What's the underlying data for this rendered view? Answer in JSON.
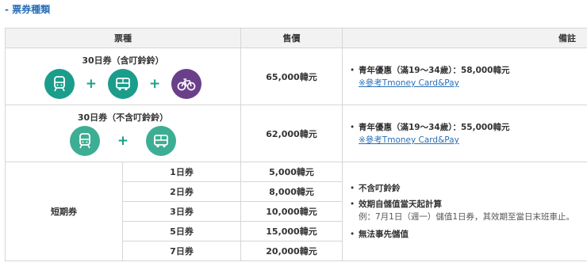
{
  "section_title": "- 票券種類",
  "headers": {
    "col1": "票種",
    "col2": "售價",
    "col3": "備註"
  },
  "pass30_with_bike": {
    "name": "30日券（含叮鈴鈴）",
    "price": "65,000韓元",
    "note": "青年優惠（滿19～34歲）：58,000韓元",
    "link": "※參考Tmoney Card&Pay",
    "icons": [
      "subway-icon",
      "bus-icon",
      "bicycle-icon"
    ],
    "plus": "+"
  },
  "pass30_no_bike": {
    "name": "30日券（不含叮鈴鈴）",
    "price": "62,000韓元",
    "note": "青年優惠（滿19～34歲）：55,000韓元",
    "link": "※參考Tmoney Card&Pay",
    "icons": [
      "subway-icon",
      "bus-icon"
    ],
    "plus": "+"
  },
  "short_term": {
    "label": "短期券",
    "rows": [
      {
        "name": "1日券",
        "price": "5,000韓元"
      },
      {
        "name": "2日券",
        "price": "8,000韓元"
      },
      {
        "name": "3日券",
        "price": "10,000韓元"
      },
      {
        "name": "5日券",
        "price": "15,000韓元"
      },
      {
        "name": "7日券",
        "price": "20,000韓元"
      }
    ],
    "notes": {
      "n1": "不含叮鈴鈴",
      "n2": "效期自儲值當天起計算",
      "n2_sub": "例：7月1日（週一）儲值1日券，其效期至當日末班車止。",
      "n3": "無法事先儲值"
    }
  },
  "colors": {
    "accent": "#2a6fb7",
    "teal": "#1b9d8c",
    "purple": "#6a3f8a",
    "header_bg": "#f2f2f2"
  }
}
